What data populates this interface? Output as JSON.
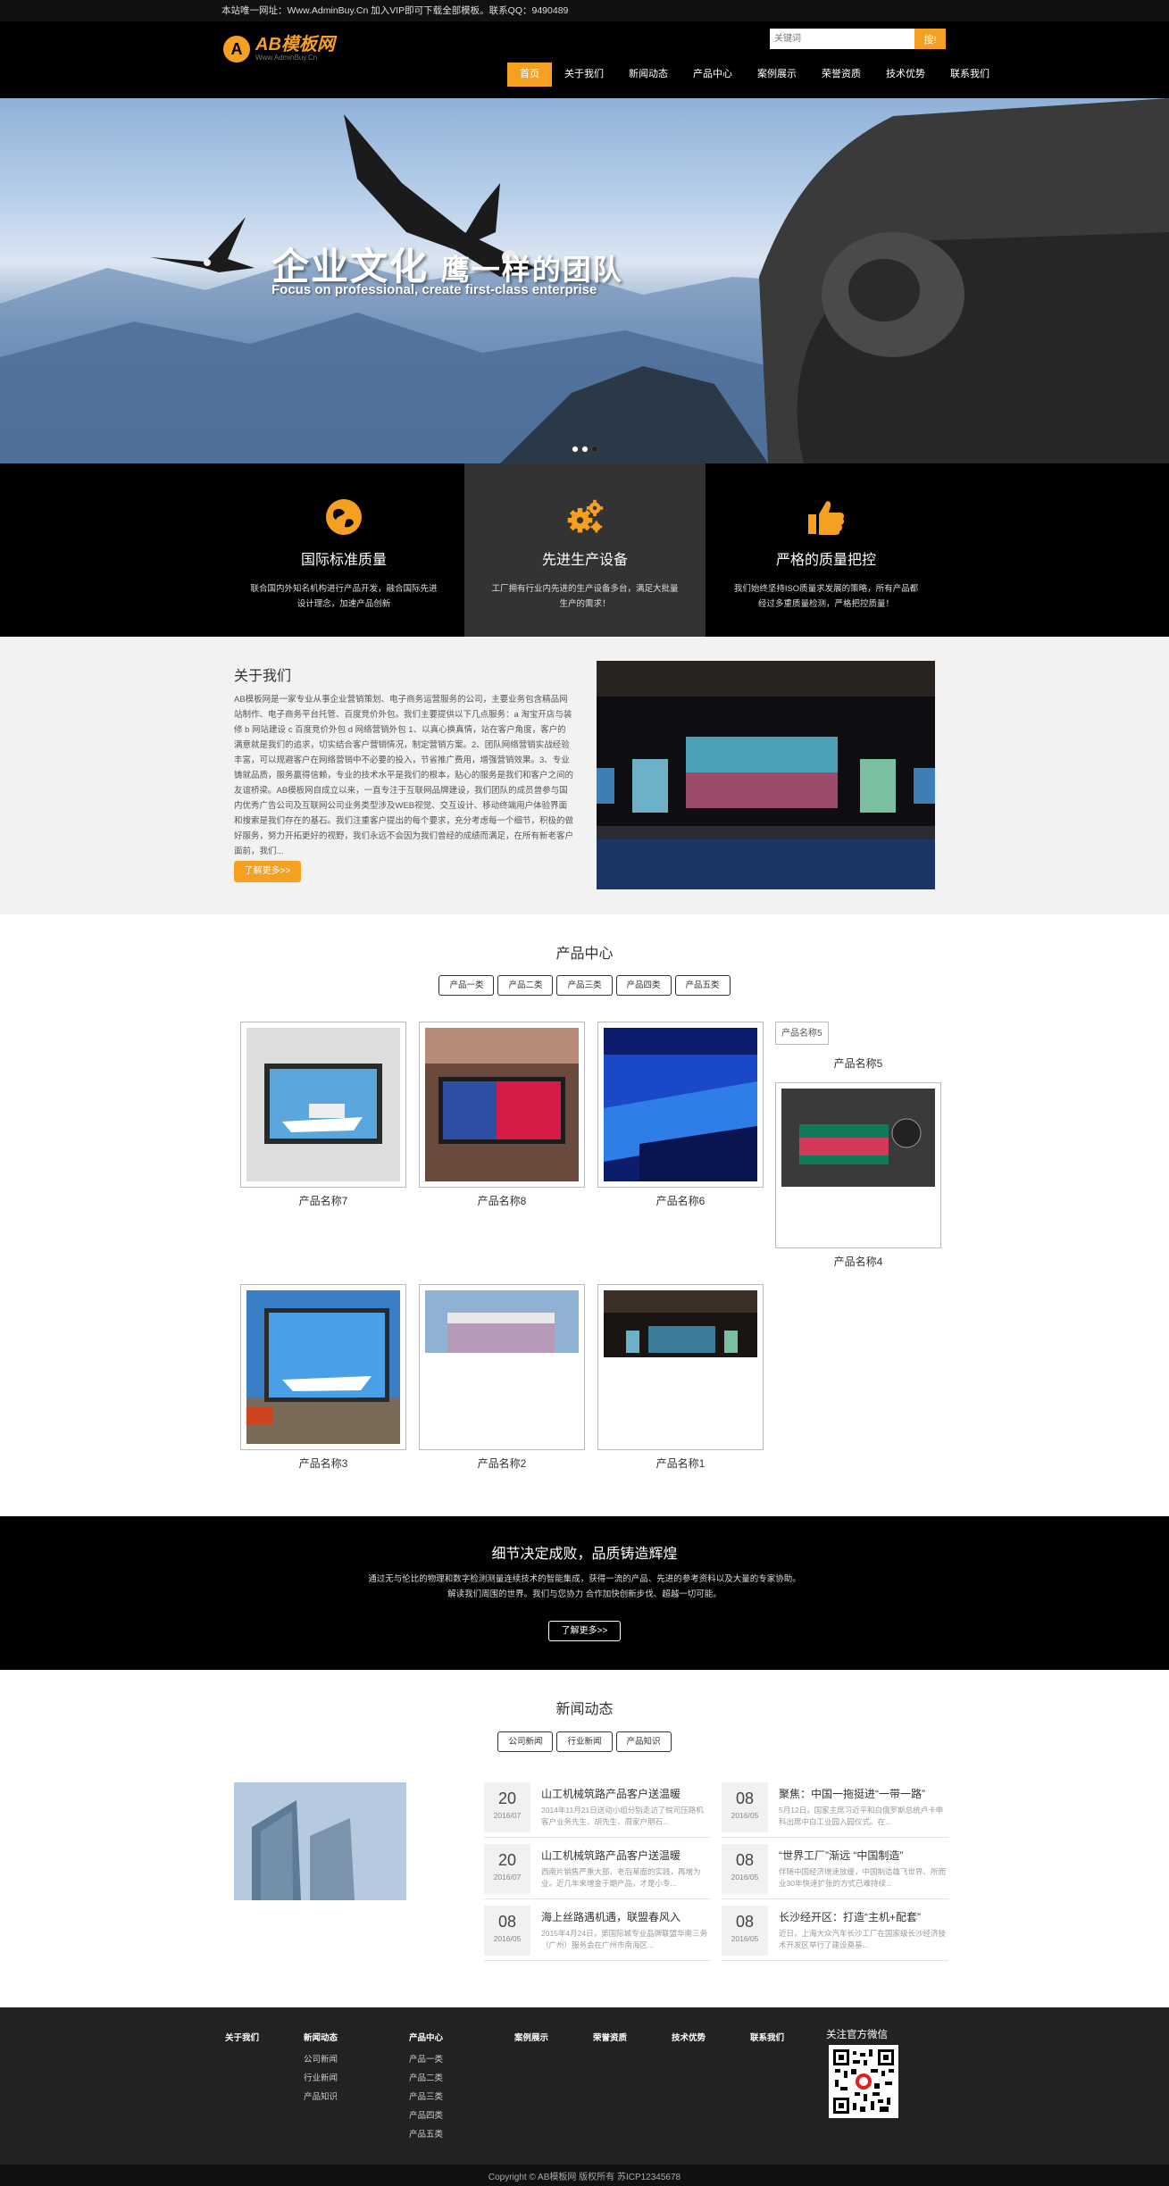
{
  "topbar": {
    "text": "本站唯一网址：Www.AdminBuy.Cn 加入VIP即可下载全部模板。联系QQ：9490489"
  },
  "header": {
    "logo_mark": "A",
    "logo_title": "AB模板网",
    "logo_sub": "Www.AdminBuy.Cn",
    "search_placeholder": "关键词",
    "search_button": "搜!",
    "nav": [
      "首页",
      "关于我们",
      "新闻动态",
      "产品中心",
      "案例展示",
      "荣誉资质",
      "技术优势",
      "联系我们"
    ],
    "active_nav": 0
  },
  "banner": {
    "heading": "企业文化",
    "heading_small": "鹰一样的团队",
    "subheading": "Focus on professional, create first-class enterprise",
    "slides": 3,
    "active_slide": 3
  },
  "features": [
    {
      "icon": "globe-icon",
      "title": "国际标准质量",
      "desc": "联合国内外知名机构进行产品开发，融合国际先进设计理念，加速产品创新"
    },
    {
      "icon": "gears-icon",
      "title": "先进生产设备",
      "desc": "工厂拥有行业内先进的生产设备多台，满足大批量生产的需求！"
    },
    {
      "icon": "thumbs-up-icon",
      "title": "严格的质量把控",
      "desc": "我们始终坚持ISO质量求发展的策略，所有产品都经过多重质量检测，严格把控质量！"
    }
  ],
  "about": {
    "title": "关于我们",
    "text": "AB模板网是一家专业从事企业营销策划、电子商务运营服务的公司，主要业务包含精品网站制作、电子商务平台托管、百度竞价外包。我们主要提供以下几点服务：a 淘宝开店与装修 b 网站建设 c 百度竞价外包 d 网络营销外包 1、以真心换真情，站在客户角度，客户的满意就是我们的追求，切实结合客户营销情况，制定营销方案。2、团队网络营销实战经验丰富，可以规避客户在网络营销中不必要的投入，节省推广费用，增强营销效果。3、专业铸就品质，服务赢得信赖，专业的技术水平是我们的根本，贴心的服务是我们和客户之间的友谊桥梁。AB模板网自成立以来，一直专注于互联网品牌建设，我们团队的成员曾参与国内优秀广告公司及互联网公司业务类型涉及WEB视觉、交互设计、移动终端用户体验界面和搜索是我们存在的基石。我们注重客户提出的每个要求，充分考虑每一个细节，积极的做好服务，努力开拓更好的视野，我们永远不会因为我们曾经的成绩而满足，在所有新老客户面前，我们...",
    "button": "了解更多>>"
  },
  "products": {
    "title": "产品中心",
    "tabs": [
      "产品一类",
      "产品二类",
      "产品三类",
      "产品四类",
      "产品五类"
    ],
    "items": [
      "产品名称7",
      "产品名称8",
      "产品名称6",
      "产品名称5",
      "产品名称4",
      "产品名称3",
      "产品名称2",
      "产品名称1"
    ],
    "broken_alt": "产品名称5"
  },
  "slogan": {
    "title": "细节决定成败，品质铸造辉煌",
    "line1": "通过无与伦比的物理和数字检测测量连续技术的智能集成，获得一流的产品、先进的参考资料以及大量的专家协助。",
    "line2": "解读我们周围的世界。我们与您协力 合作加快创新步伐、超越一切可能。",
    "button": "了解更多>>"
  },
  "news": {
    "title": "新闻动态",
    "tabs": [
      "公司新闻",
      "行业新闻",
      "产品知识"
    ],
    "items": [
      {
        "day": "20",
        "ym": "2016/07",
        "title": "山工机械筑路产品客户送温暖",
        "desc": "2014年11月21日送动小组分别走访了皖司压路机客户业务先生、胡先生、周家户朋石..."
      },
      {
        "day": "08",
        "ym": "2016/05",
        "title": "聚焦：中国一拖挺进“一带一路”",
        "desc": "5月12日，国家主席习近平和白俄罗斯总统卢卡申科出席中白工业园入园仪式。在..."
      },
      {
        "day": "20",
        "ym": "2016/07",
        "title": "山工机械筑路产品客户送温暖",
        "desc": "西南片销售严重大部、老后某面的实践，再增为业。近几年来增金于期产品，才是小专..."
      },
      {
        "day": "08",
        "ym": "2016/05",
        "title": "“世界工厂”渐远 “中国制造”",
        "desc": "伴随中国经济增速放缓，中国制造雄飞世界、所而业30年快速扩张的方式已难持续..."
      },
      {
        "day": "08",
        "ym": "2016/05",
        "title": "海上丝路遇机遇，联盟春风入",
        "desc": "2015年4月24日，第国际城专业品牌联盟华南三务（广州）服务会在广州市南海区..."
      },
      {
        "day": "08",
        "ym": "2016/05",
        "title": "长沙经开区：打造“主机+配套”",
        "desc": "近日，上海大众汽车长沙工厂在国家级长沙经济技术开发区举行了建设奠基..."
      }
    ]
  },
  "footer": {
    "columns": [
      {
        "head": "关于我们",
        "links": []
      },
      {
        "head": "新闻动态",
        "links": [
          "公司新闻",
          "行业新闻",
          "产品知识"
        ]
      },
      {
        "head": "产品中心",
        "links": [
          "产品一类",
          "产品二类",
          "产品三类",
          "产品四类",
          "产品五类"
        ]
      },
      {
        "head": "案例展示",
        "links": []
      },
      {
        "head": "荣誉资质",
        "links": []
      },
      {
        "head": "技术优势",
        "links": []
      },
      {
        "head": "联系我们",
        "links": []
      }
    ],
    "wechat_title": "关注官方微信",
    "copyright": "Copyright © AB模板网 版权所有   苏ICP12345678"
  },
  "colors": {
    "accent": "#f6a021",
    "dark": "#000000",
    "footer": "#222222"
  }
}
